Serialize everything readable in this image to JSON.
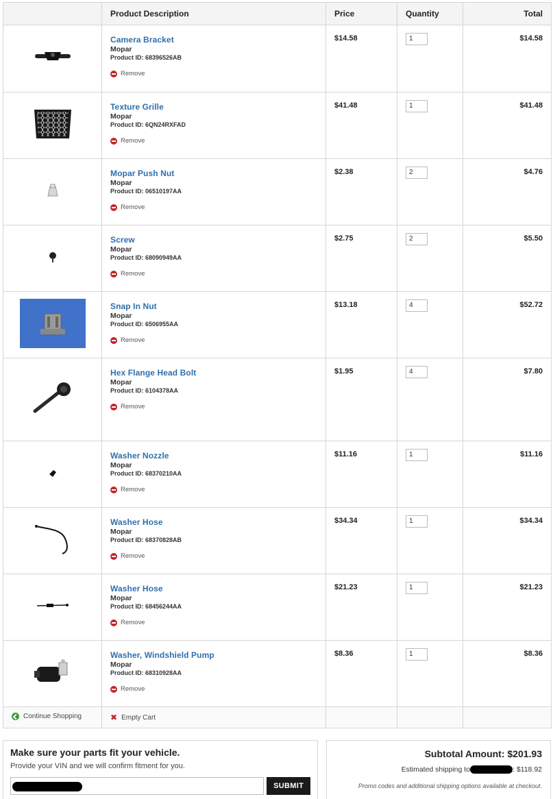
{
  "headers": {
    "description": "Product Description",
    "price": "Price",
    "quantity": "Quantity",
    "total": "Total"
  },
  "remove_label": "Remove",
  "items": [
    {
      "name": "Camera Bracket",
      "brand": "Mopar",
      "pid": "Product ID: 68396526AB",
      "price": "$14.58",
      "qty": "1",
      "total": "$14.58"
    },
    {
      "name": "Texture Grille",
      "brand": "Mopar",
      "pid": "Product ID: 6QN24RXFAD",
      "price": "$41.48",
      "qty": "1",
      "total": "$41.48"
    },
    {
      "name": "Mopar Push Nut",
      "brand": "Mopar",
      "pid": "Product ID: 06510197AA",
      "price": "$2.38",
      "qty": "2",
      "total": "$4.76"
    },
    {
      "name": "Screw",
      "brand": "Mopar",
      "pid": "Product ID: 68090949AA",
      "price": "$2.75",
      "qty": "2",
      "total": "$5.50"
    },
    {
      "name": "Snap In Nut",
      "brand": "Mopar",
      "pid": "Product ID: 6506955AA",
      "price": "$13.18",
      "qty": "4",
      "total": "$52.72"
    },
    {
      "name": "Hex Flange Head Bolt",
      "brand": "Mopar",
      "pid": "Product ID: 6104378AA",
      "price": "$1.95",
      "qty": "4",
      "total": "$7.80"
    },
    {
      "name": "Washer Nozzle",
      "brand": "Mopar",
      "pid": "Product ID: 68370210AA",
      "price": "$11.16",
      "qty": "1",
      "total": "$11.16"
    },
    {
      "name": "Washer Hose",
      "brand": "Mopar",
      "pid": "Product ID: 68370828AB",
      "price": "$34.34",
      "qty": "1",
      "total": "$34.34"
    },
    {
      "name": "Washer Hose",
      "brand": "Mopar",
      "pid": "Product ID: 68456244AA",
      "price": "$21.23",
      "qty": "1",
      "total": "$21.23"
    },
    {
      "name": "Washer, Windshield Pump",
      "brand": "Mopar",
      "pid": "Product ID: 68310928AA",
      "price": "$8.36",
      "qty": "1",
      "total": "$8.36"
    }
  ],
  "footer": {
    "continue_label": "Continue Shopping",
    "empty_label": "Empty Cart"
  },
  "vin": {
    "title": "Make sure your parts fit your vehicle.",
    "subtitle": "Provide your VIN and we will confirm fitment for you.",
    "submit_label": "SUBMIT"
  },
  "summary": {
    "subtotal": "Subtotal Amount: $201.93",
    "shipping_prefix": "Estimated shipping to",
    "shipping_amount": ": $118.92",
    "promo_note": "Promo codes and additional shipping options available at checkout."
  },
  "colors": {
    "link": "#2f6fae",
    "remove": "#c0272d",
    "continue": "#3a9a3a",
    "button": "#1a1a1a"
  }
}
